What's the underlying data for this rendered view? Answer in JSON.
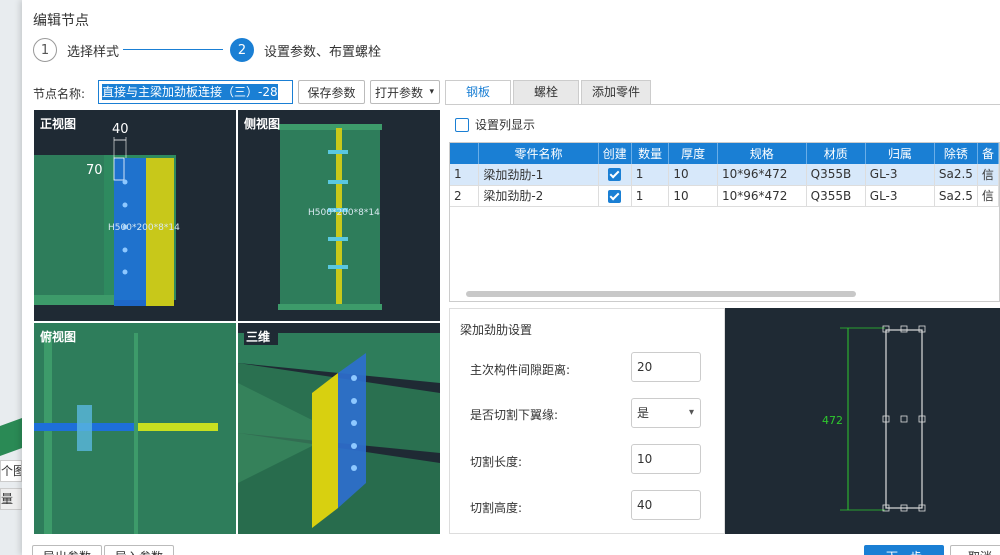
{
  "background": {
    "tab1": "个图:",
    "tab2": "量"
  },
  "dialog": {
    "title": "编辑节点",
    "steps": [
      {
        "num": "1",
        "label": "选择样式"
      },
      {
        "num": "2",
        "label": "设置参数、布置螺栓"
      }
    ],
    "node_name_label": "节点名称:",
    "node_name_value": "直接与主梁加劲板连接（三）-28",
    "save_params": "保存参数",
    "open_params": "打开参数",
    "views": {
      "front": {
        "label": "正视图",
        "dim_top": "40",
        "dim_left": "70",
        "section": "H500*200*8*14"
      },
      "side": {
        "label": "侧视图",
        "section": "H500*200*8*14"
      },
      "top": {
        "label": "俯视图"
      },
      "three_d": {
        "label": "三维"
      }
    },
    "tabs": [
      "钢板",
      "螺栓",
      "添加零件"
    ],
    "set_columns": "设置列显示",
    "table": {
      "headers": [
        "",
        "零件名称",
        "创建",
        "数量",
        "厚度",
        "规格",
        "材质",
        "归属",
        "除锈",
        "备"
      ],
      "rows": [
        [
          "1",
          "梁加劲肋-1",
          "",
          "1",
          "10",
          "10*96*472",
          "Q355B",
          "GL-3",
          "Sa2.5",
          "信"
        ],
        [
          "2",
          "梁加劲肋-2",
          "",
          "1",
          "10",
          "10*96*472",
          "Q355B",
          "GL-3",
          "Sa2.5",
          "信"
        ]
      ]
    },
    "settings": {
      "title": "梁加劲肋设置",
      "gap_label": "主次构件间隙距离:",
      "gap_value": "20",
      "cut_label": "是否切割下翼缘:",
      "cut_value": "是",
      "cut_length_label": "切割长度:",
      "cut_length_value": "10",
      "cut_height_label": "切割高度:",
      "cut_height_value": "40"
    },
    "preview": {
      "dim": "472"
    },
    "bottom": {
      "import": "导出参数",
      "export": "导入参数",
      "next": "下一步",
      "cancel": "取消"
    }
  },
  "colors": {
    "accent": "#1a7fd4",
    "steel_green": "#2e7d5b",
    "plate_blue": "#1e6fd9",
    "plate_yellow": "#c8c81a"
  }
}
